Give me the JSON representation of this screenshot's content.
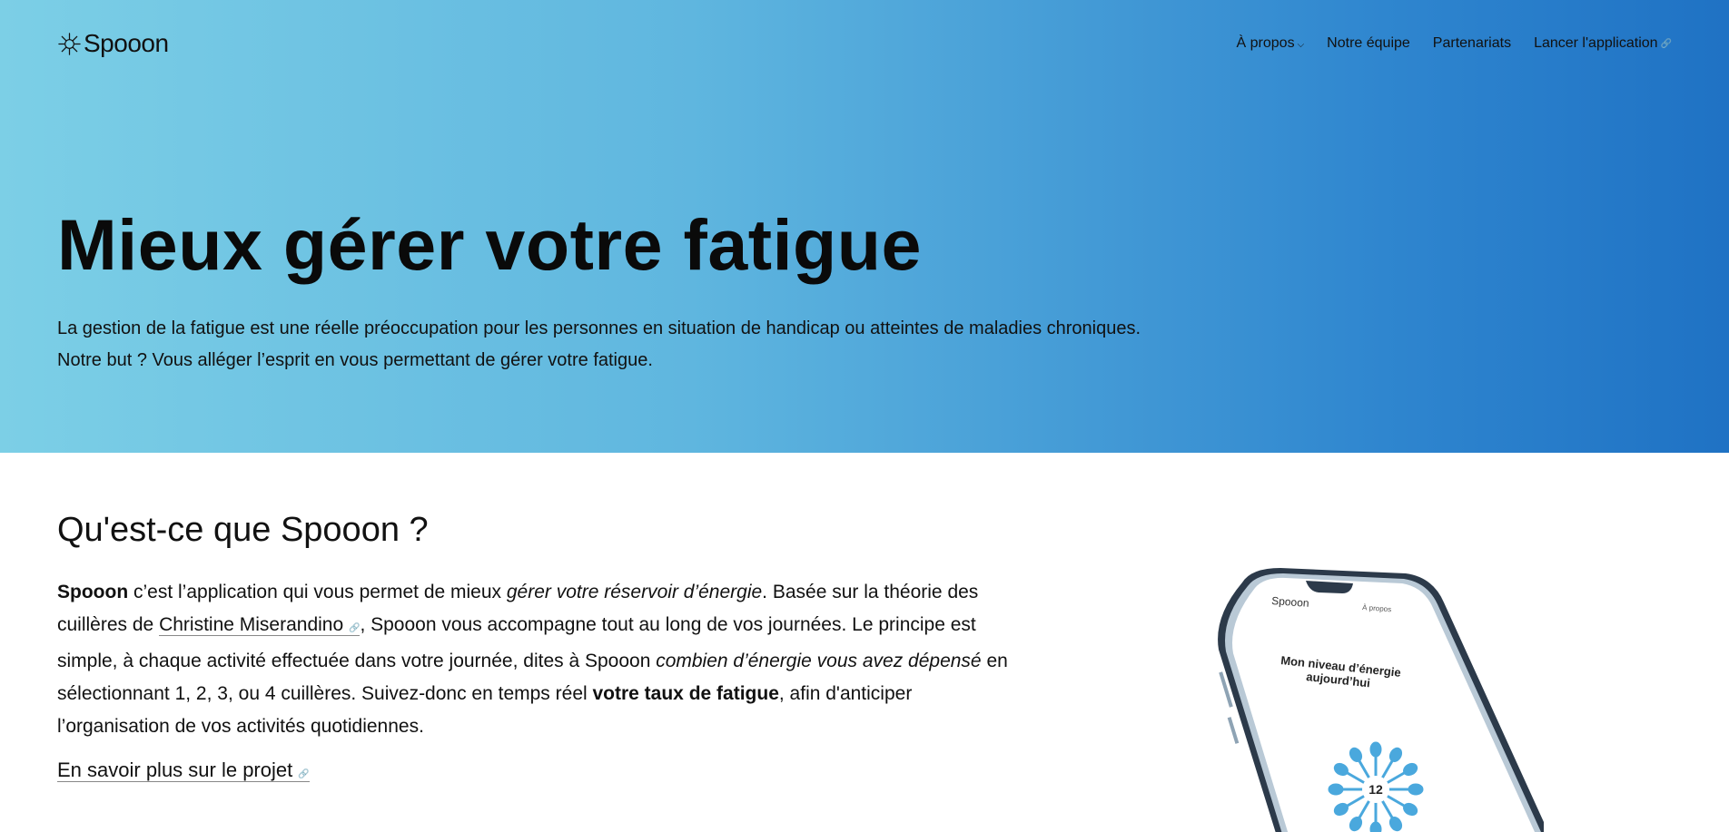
{
  "brand": {
    "name": "Spooon"
  },
  "nav": {
    "about": "À propos",
    "team": "Notre équipe",
    "partners": "Partenariats",
    "launch": "Lancer l'application"
  },
  "hero": {
    "title": "Mieux gérer votre fatigue",
    "line1": "La gestion de la fatigue est une réelle préoccupation pour les personnes en situation de handicap ou atteintes de maladies chroniques.",
    "line2": "Notre but ? Vous alléger l’esprit en vous permettant de gérer votre fatigue."
  },
  "section": {
    "title": "Qu'est-ce que Spooon ?",
    "p_strong1": "Spooon",
    "p_t1": " c’est l’application qui vous permet de mieux ",
    "p_em1": "gérer votre réservoir d’énergie",
    "p_t2": ". Basée sur la théorie des cuillères de ",
    "p_link": "Christine Miserandino",
    "p_t3": ", Spooon vous accompagne tout au long de vos journées. Le principe est simple, à chaque activité effectuée dans votre journée, dites à Spooon ",
    "p_em2": "combien d’énergie vous avez dépensé",
    "p_t4": " en sélectionnant 1, 2, 3, ou 4 cuillères. Suivez-donc en temps réel ",
    "p_strong2": "votre taux de fatigue",
    "p_t5": ", afin d'anticiper l’organisation de vos activités quotidiennes.",
    "more": "En savoir plus sur le projet"
  },
  "phone": {
    "brand": "Spooon",
    "about": "À propos",
    "heading1": "Mon niveau d’énergie",
    "heading2": "aujourd’hui",
    "level": "12"
  },
  "colors": {
    "hero_start": "#7ccfe6",
    "hero_end": "#1f72c4",
    "spoon": "#4aa8dd"
  }
}
